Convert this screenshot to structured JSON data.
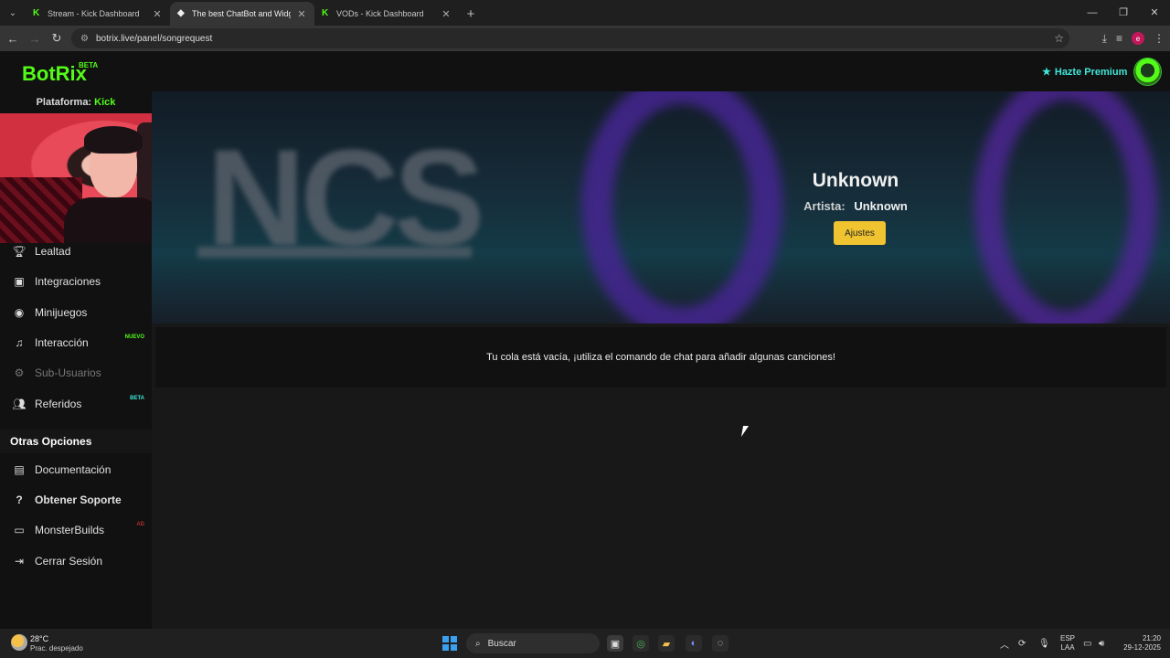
{
  "browser": {
    "tabs": [
      {
        "title": "Stream - Kick Dashboard",
        "active": false
      },
      {
        "title": "The best ChatBot and Widgets",
        "active": true
      },
      {
        "title": "VODs - Kick Dashboard",
        "active": false
      }
    ],
    "url": "botrix.live/panel/songrequest",
    "profile_initial": "e"
  },
  "header": {
    "logo": "BotRix",
    "logo_badge": "BETA",
    "premium_label": "Hazte Premium"
  },
  "sidebar": {
    "platform_label": "Plataforma:",
    "platform_value": "Kick",
    "items": [
      {
        "label": "Lealtad",
        "icon": "trophy-icon"
      },
      {
        "label": "Integraciones",
        "icon": "integrations-icon"
      },
      {
        "label": "Minijuegos",
        "icon": "gamepad-icon"
      },
      {
        "label": "Interacción",
        "icon": "music-icon",
        "badge": "NUEVO"
      },
      {
        "label": "Sub-Usuarios",
        "icon": "users-cog-icon",
        "disabled": true
      },
      {
        "label": "Referidos",
        "icon": "users-icon",
        "badge": "BETA"
      }
    ],
    "other_heading": "Otras Opciones",
    "other_items": [
      {
        "label": "Documentación",
        "icon": "book-icon"
      },
      {
        "label": "Obtener Soporte",
        "icon": "question-icon"
      },
      {
        "label": "MonsterBuilds",
        "icon": "laptop-icon",
        "badge": "AD"
      },
      {
        "label": "Cerrar Sesión",
        "icon": "logout-icon"
      }
    ]
  },
  "player": {
    "title": "Unknown",
    "artist_label": "Artista:",
    "artist": "Unknown",
    "settings_button": "Ajustes"
  },
  "queue": {
    "empty_message": "Tu cola está vacía, ¡utiliza el comando de chat para añadir algunas canciones!"
  },
  "taskbar": {
    "temperature": "28°C",
    "weather": "Prac. despejado",
    "search_placeholder": "Buscar",
    "lang_top": "ESP",
    "lang_bottom": "LAA",
    "time": "21:20",
    "date": "29-12-2025"
  }
}
